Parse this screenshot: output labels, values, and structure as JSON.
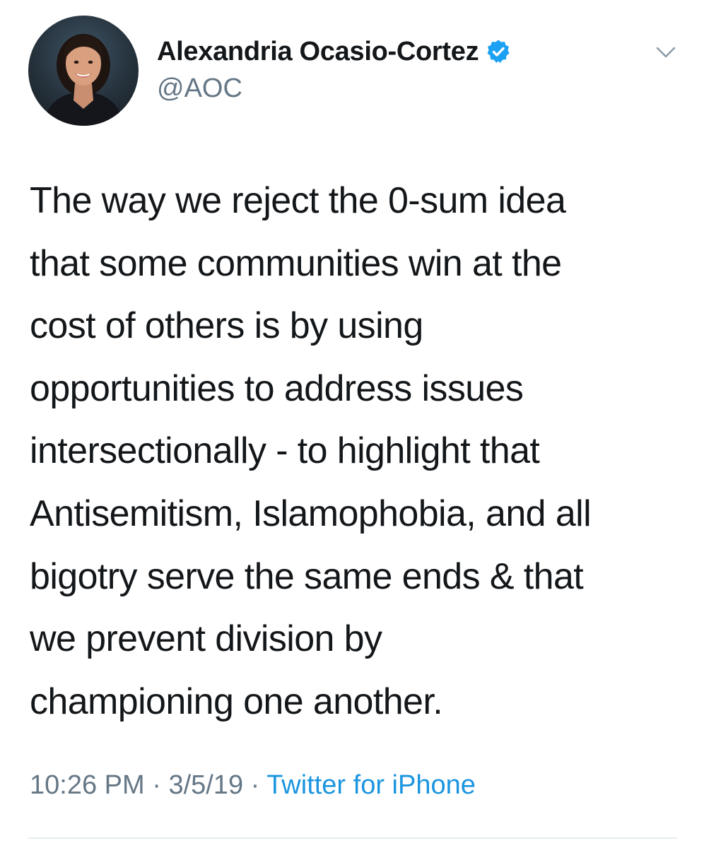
{
  "author": {
    "display_name": "Alexandria Ocasio-Cortez",
    "handle": "@AOC",
    "verified": true,
    "verified_badge_color": "#1da1f2"
  },
  "tweet": {
    "text_lines": [
      "The way we reject the 0-sum idea",
      "that some communities win at the",
      "cost of others is by using",
      "opportunities to address issues",
      "intersectionally - to highlight that",
      "Antisemitism, Islamophobia, and all",
      "bigotry serve the same ends & that",
      "we prevent division by",
      "championing one another."
    ]
  },
  "meta": {
    "time": "10:26 PM",
    "date": "3/5/19",
    "separator": "·",
    "source": "Twitter for iPhone"
  },
  "icons": {
    "verified": "verified-badge-icon",
    "caret": "chevron-down-icon"
  },
  "colors": {
    "text": "#14171a",
    "secondary": "#657786",
    "link": "#1b95e0",
    "divider": "#e6ecf0"
  }
}
